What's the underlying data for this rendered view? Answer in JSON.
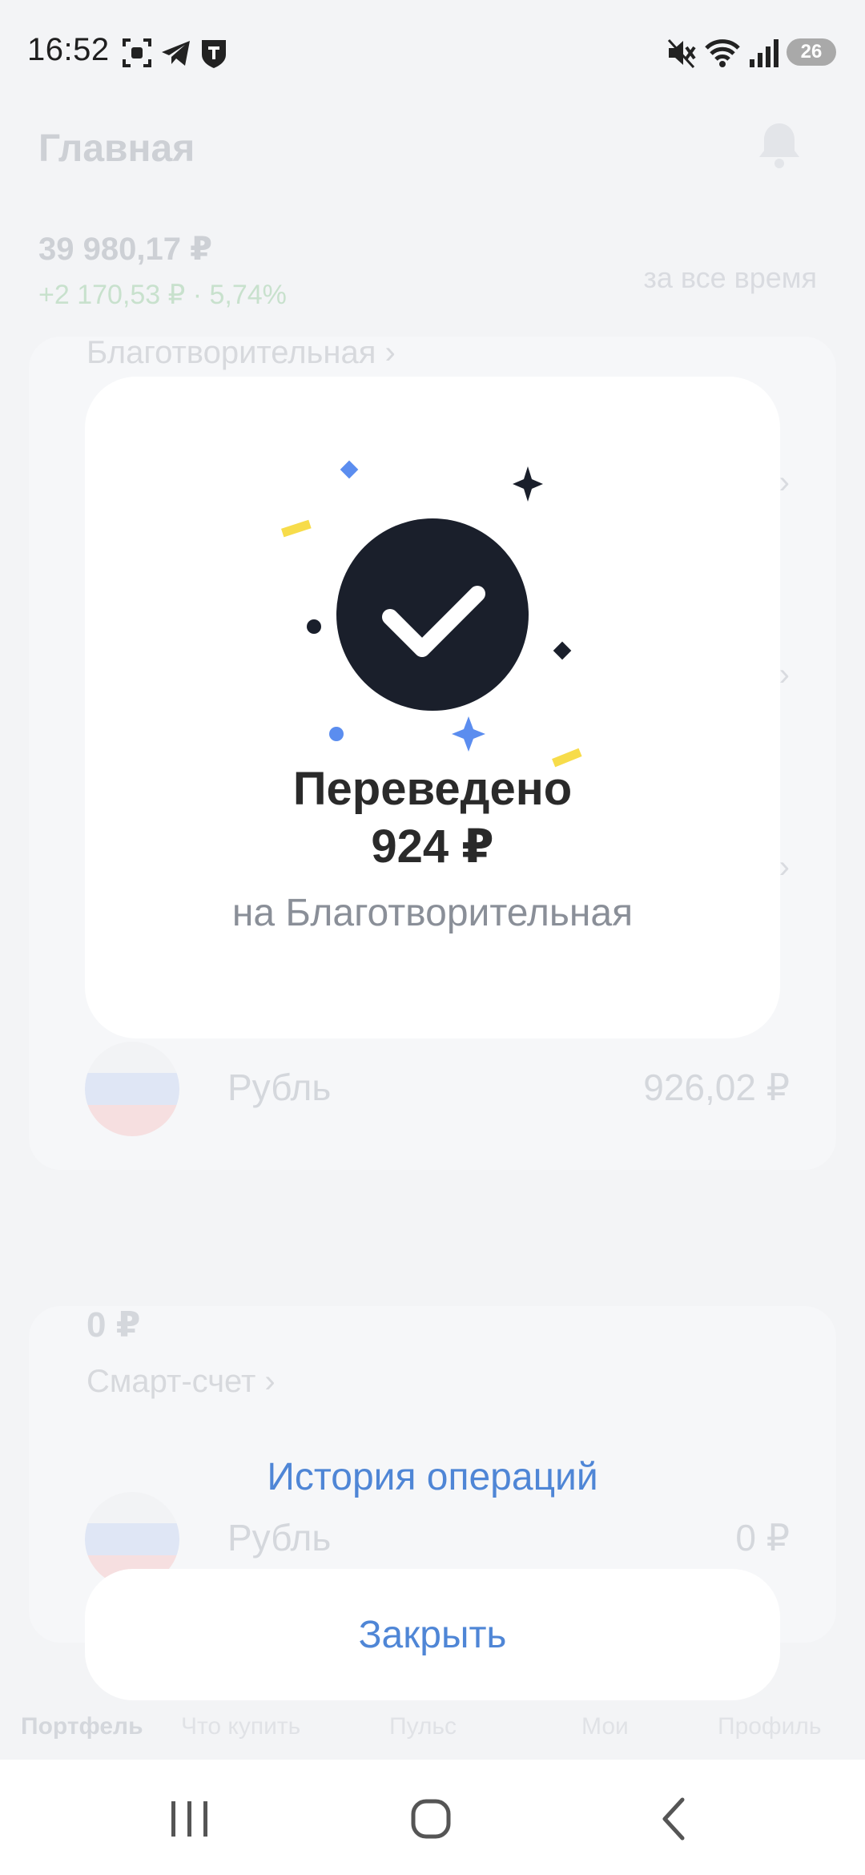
{
  "status_bar": {
    "time": "16:52",
    "battery_level": "26",
    "left_icons": [
      "screenshot-icon",
      "telegram-icon",
      "tbank-icon"
    ],
    "right_icons": [
      "mute-icon",
      "wifi-icon",
      "signal-icon",
      "battery-icon"
    ]
  },
  "background": {
    "title": "Главная",
    "balance": "39 980,17 ₽",
    "change": "+2 170,53 ₽ · 5,74%",
    "period": "за все время",
    "account1_name": "Благотворительная ›",
    "account1_currency": "Рубль",
    "account1_amount": "926,02 ₽",
    "account2_balance": "0 ₽",
    "account2_name": "Смарт-счет ›",
    "account2_currency": "Рубль",
    "account2_amount": "0 ₽",
    "tabs": [
      "Портфель",
      "Что купить",
      "Пульс",
      "Мои",
      "Профиль"
    ]
  },
  "modal": {
    "title_line1": "Переведено",
    "title_line2": "924 ₽",
    "subtitle": "на Благотворительная",
    "icon": "success-check-icon",
    "colors": {
      "accent_blue": "#5b8def",
      "accent_yellow": "#f7dc4a",
      "dark": "#1a1f2b"
    }
  },
  "actions": {
    "history_label": "История операций",
    "close_label": "Закрыть",
    "link_color": "#4f86d6"
  },
  "nav_bar": {
    "recent_icon": "recent-apps-icon",
    "home_icon": "home-icon",
    "back_icon": "back-icon"
  }
}
